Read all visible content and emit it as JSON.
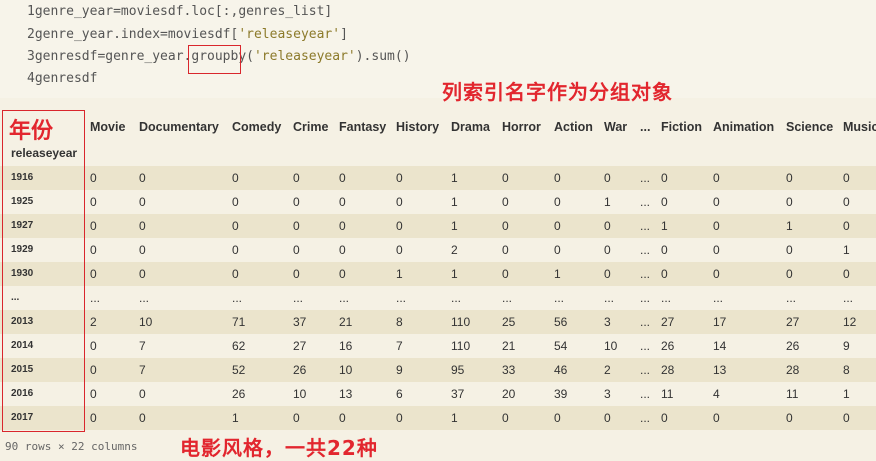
{
  "code": {
    "lines": [
      {
        "num": "1",
        "text": "genre_year=moviesdf.loc[:,genres_list]"
      },
      {
        "num": "2",
        "pre": "genre_year.index=moviesdf[",
        "str": "'releaseyear'",
        "post": "]"
      },
      {
        "num": "3",
        "pre": "genresdf=genre_year.groupby(",
        "str": "'releaseyear'",
        "post": ").sum()"
      },
      {
        "num": "4",
        "text": "genresdf"
      }
    ]
  },
  "annotations": {
    "columns_note": "列索引名字作为分组对象",
    "year_note": "年份",
    "genre_note": "电影风格，一共22种"
  },
  "table": {
    "index_name": "releaseyear",
    "columns": [
      "Movie",
      "Documentary",
      "Comedy",
      "Crime",
      "Fantasy",
      "History",
      "Drama",
      "Horror",
      "Action",
      "War",
      "...",
      "Fiction",
      "Animation",
      "Science",
      "Music"
    ],
    "rows": [
      {
        "year": "1916",
        "values": [
          "0",
          "0",
          "0",
          "0",
          "0",
          "0",
          "1",
          "0",
          "0",
          "0",
          "...",
          "0",
          "0",
          "0",
          "0"
        ]
      },
      {
        "year": "1925",
        "values": [
          "0",
          "0",
          "0",
          "0",
          "0",
          "0",
          "1",
          "0",
          "0",
          "1",
          "...",
          "0",
          "0",
          "0",
          "0"
        ]
      },
      {
        "year": "1927",
        "values": [
          "0",
          "0",
          "0",
          "0",
          "0",
          "0",
          "1",
          "0",
          "0",
          "0",
          "...",
          "1",
          "0",
          "1",
          "0"
        ]
      },
      {
        "year": "1929",
        "values": [
          "0",
          "0",
          "0",
          "0",
          "0",
          "0",
          "2",
          "0",
          "0",
          "0",
          "...",
          "0",
          "0",
          "0",
          "1"
        ]
      },
      {
        "year": "1930",
        "values": [
          "0",
          "0",
          "0",
          "0",
          "0",
          "1",
          "1",
          "0",
          "1",
          "0",
          "...",
          "0",
          "0",
          "0",
          "0"
        ]
      },
      {
        "year": "...",
        "values": [
          "...",
          "...",
          "...",
          "...",
          "...",
          "...",
          "...",
          "...",
          "...",
          "...",
          "...",
          "...",
          "...",
          "...",
          "..."
        ]
      },
      {
        "year": "2013",
        "values": [
          "2",
          "10",
          "71",
          "37",
          "21",
          "8",
          "110",
          "25",
          "56",
          "3",
          "...",
          "27",
          "17",
          "27",
          "12"
        ]
      },
      {
        "year": "2014",
        "values": [
          "0",
          "7",
          "62",
          "27",
          "16",
          "7",
          "110",
          "21",
          "54",
          "10",
          "...",
          "26",
          "14",
          "26",
          "9"
        ]
      },
      {
        "year": "2015",
        "values": [
          "0",
          "7",
          "52",
          "26",
          "10",
          "9",
          "95",
          "33",
          "46",
          "2",
          "...",
          "28",
          "13",
          "28",
          "8"
        ]
      },
      {
        "year": "2016",
        "values": [
          "0",
          "0",
          "26",
          "10",
          "13",
          "6",
          "37",
          "20",
          "39",
          "3",
          "...",
          "11",
          "4",
          "11",
          "1"
        ]
      },
      {
        "year": "2017",
        "values": [
          "0",
          "0",
          "1",
          "0",
          "0",
          "0",
          "1",
          "0",
          "0",
          "0",
          "...",
          "0",
          "0",
          "0",
          "0"
        ]
      }
    ],
    "footer": "90 rows × 22 columns"
  }
}
